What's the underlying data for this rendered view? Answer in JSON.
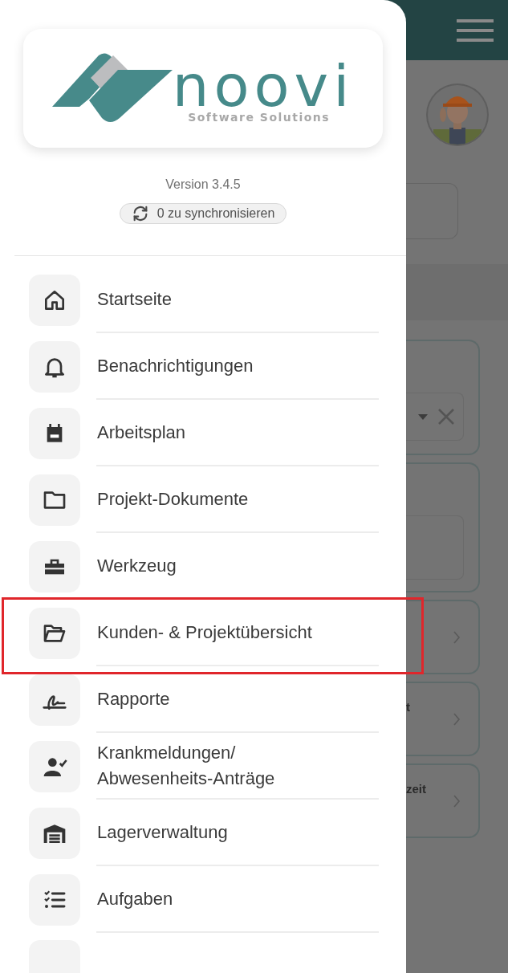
{
  "background": {
    "cards": [
      {
        "kind": "field"
      },
      {
        "kind": "field2"
      },
      {
        "kind": "link"
      },
      {
        "kind": "link",
        "text": "t"
      },
      {
        "kind": "link",
        "text": "zeit"
      }
    ]
  },
  "drawer": {
    "logo": {
      "name": "noovi",
      "tagline": "Software Solutions"
    },
    "version": "Version 3.4.5",
    "sync": "0 zu synchronisieren",
    "items": [
      {
        "label": "Startseite",
        "highlighted": false
      },
      {
        "label": "Benachrichtigungen",
        "highlighted": false
      },
      {
        "label": "Arbeitsplan",
        "highlighted": false
      },
      {
        "label": "Projekt-Dokumente",
        "highlighted": false
      },
      {
        "label": "Werkzeug",
        "highlighted": false
      },
      {
        "label": "Kunden- & Projektübersicht",
        "highlighted": true
      },
      {
        "label": "Rapporte",
        "highlighted": false
      },
      {
        "label": "Krankmeldungen/ Abwesenheits-Anträge",
        "highlighted": false
      },
      {
        "label": "Lagerverwaltung",
        "highlighted": false
      },
      {
        "label": "Aufgaben",
        "highlighted": false
      }
    ]
  }
}
